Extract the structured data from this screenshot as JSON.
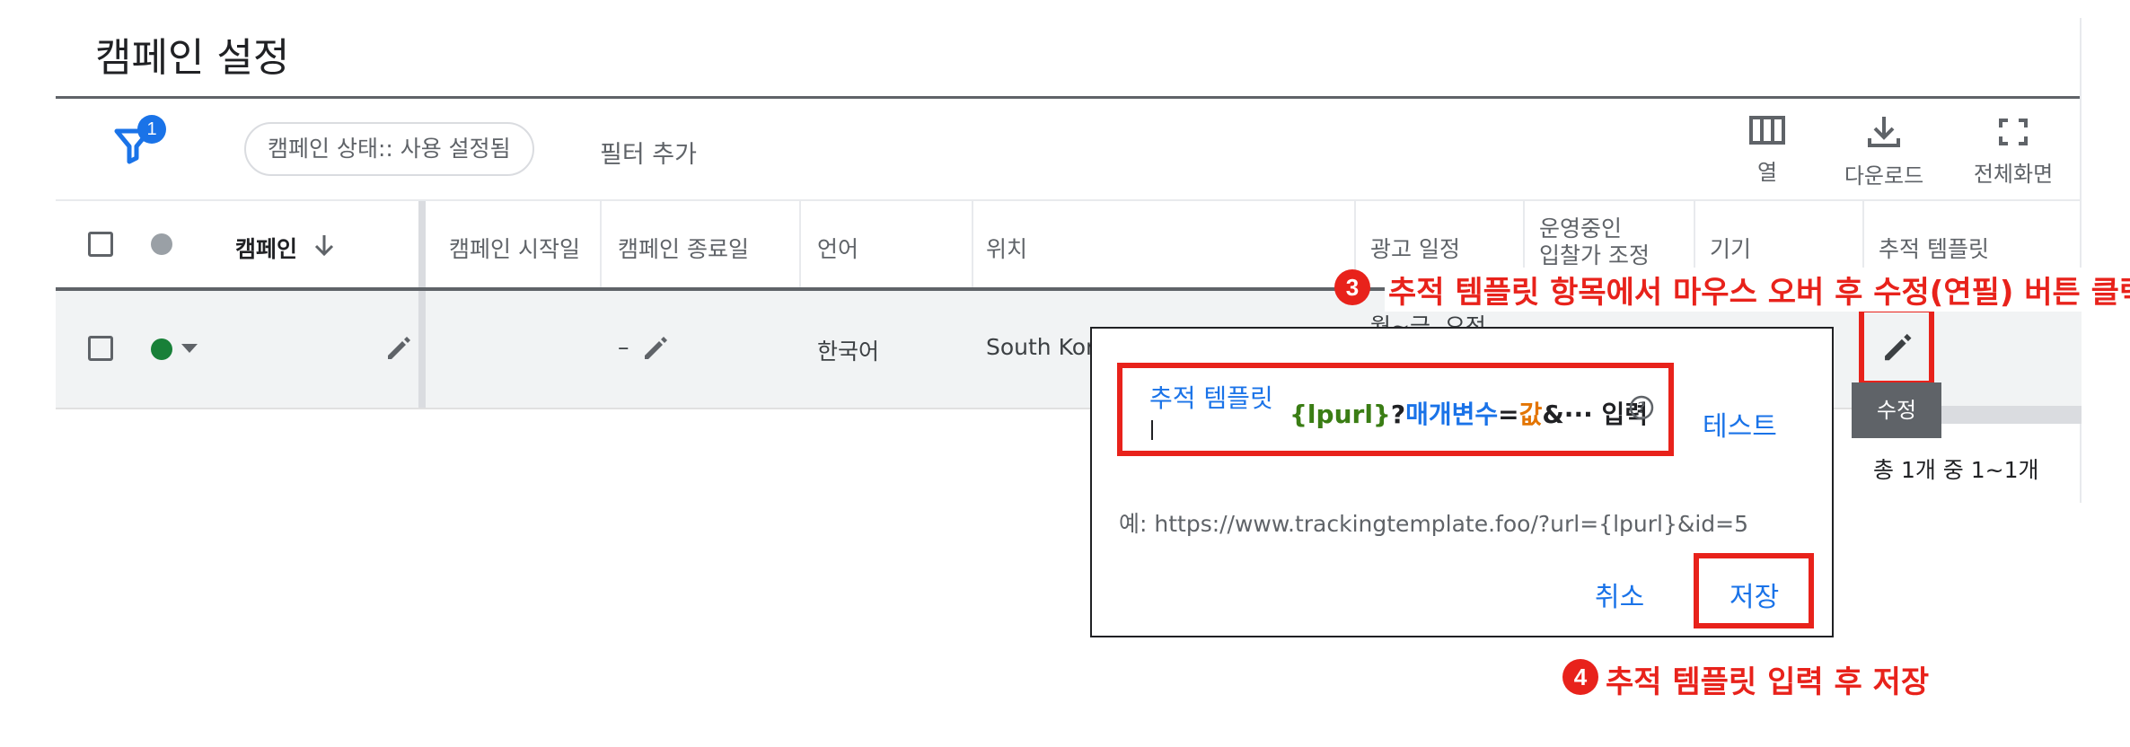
{
  "page": {
    "title": "캠페인 설정"
  },
  "toolbar": {
    "filter_badge": "1",
    "filter_chip": "캠페인 상태:: 사용 설정됨",
    "add_filter": "필터 추가",
    "columns_label": "열",
    "download_label": "다운로드",
    "fullscreen_label": "전체화면"
  },
  "table": {
    "headers": {
      "campaign": "캠페인",
      "start_date": "캠페인 시작일",
      "end_date": "캠페인 종료일",
      "language": "언어",
      "location": "위치",
      "ad_schedule": "광고 일정",
      "active_bid_adj_1": "운영중인",
      "active_bid_adj_2": "입찰가 조정",
      "device": "기기",
      "tracking_template": "추적 템플릿"
    },
    "row": {
      "status_color": "#188038",
      "end_date": "–",
      "language": "한국어",
      "location": "South Kore",
      "ad_schedule": "월~금, 오전"
    },
    "tooltip_edit": "수정",
    "pagination": "총 1개 중 1~1개"
  },
  "dialog": {
    "field_label": "추적 템플릿",
    "placeholder_parts": {
      "lpurl": "{lpurl}",
      "q": "?",
      "param": "매개변수",
      "eq": "=",
      "value": "값",
      "rest": "&··· 입력"
    },
    "test_label": "테스트",
    "example": "예: https://www.trackingtemplate.foo/?url={lpurl}&id=5",
    "cancel_label": "취소",
    "save_label": "저장"
  },
  "annotations": {
    "step3_num": "3",
    "step3_text": "추적 템플릿 항목에서 마우스 오버 후 수정(연필) 버튼 클릭",
    "step4_num": "4",
    "step4_text": "추적 템플릿 입력 후 저장",
    "highlight_color": "#e8221b"
  },
  "icons": [
    "filter-icon",
    "columns-icon",
    "download-icon",
    "fullscreen-icon",
    "sort-arrow-down-icon",
    "pencil-icon",
    "help-circle-icon",
    "dropdown-arrow-icon"
  ]
}
